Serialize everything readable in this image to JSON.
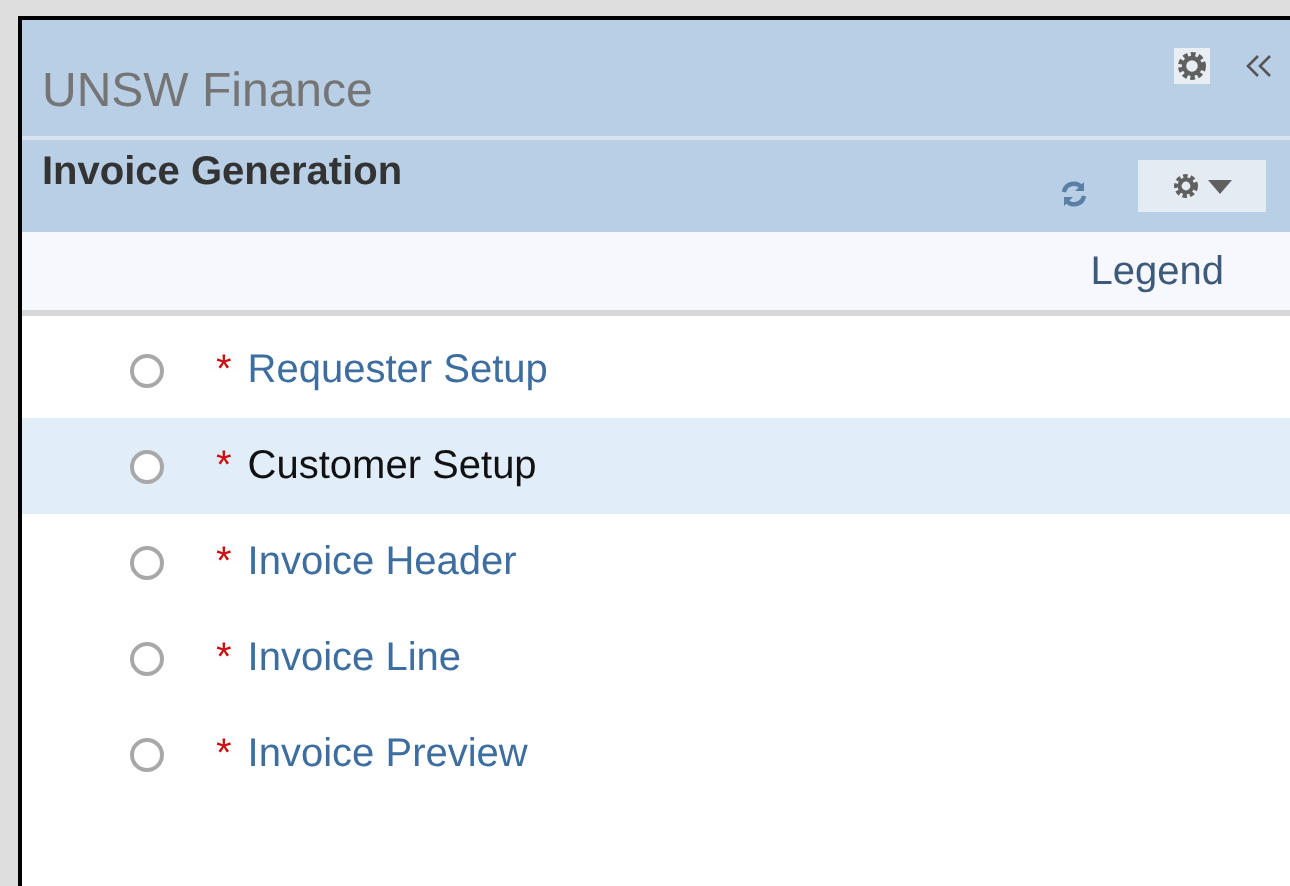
{
  "header": {
    "title": "UNSW Finance"
  },
  "section": {
    "title": "Invoice Generation"
  },
  "legend": {
    "label": "Legend"
  },
  "steps": [
    {
      "mark": "*",
      "label": "Requester Setup",
      "checked": false,
      "selected": false
    },
    {
      "mark": "*",
      "label": "Customer Setup",
      "checked": false,
      "selected": true
    },
    {
      "mark": "*",
      "label": "Invoice Header",
      "checked": false,
      "selected": false
    },
    {
      "mark": "*",
      "label": "Invoice Line",
      "checked": false,
      "selected": false
    },
    {
      "mark": "*",
      "label": "Invoice Preview",
      "checked": false,
      "selected": false
    }
  ]
}
